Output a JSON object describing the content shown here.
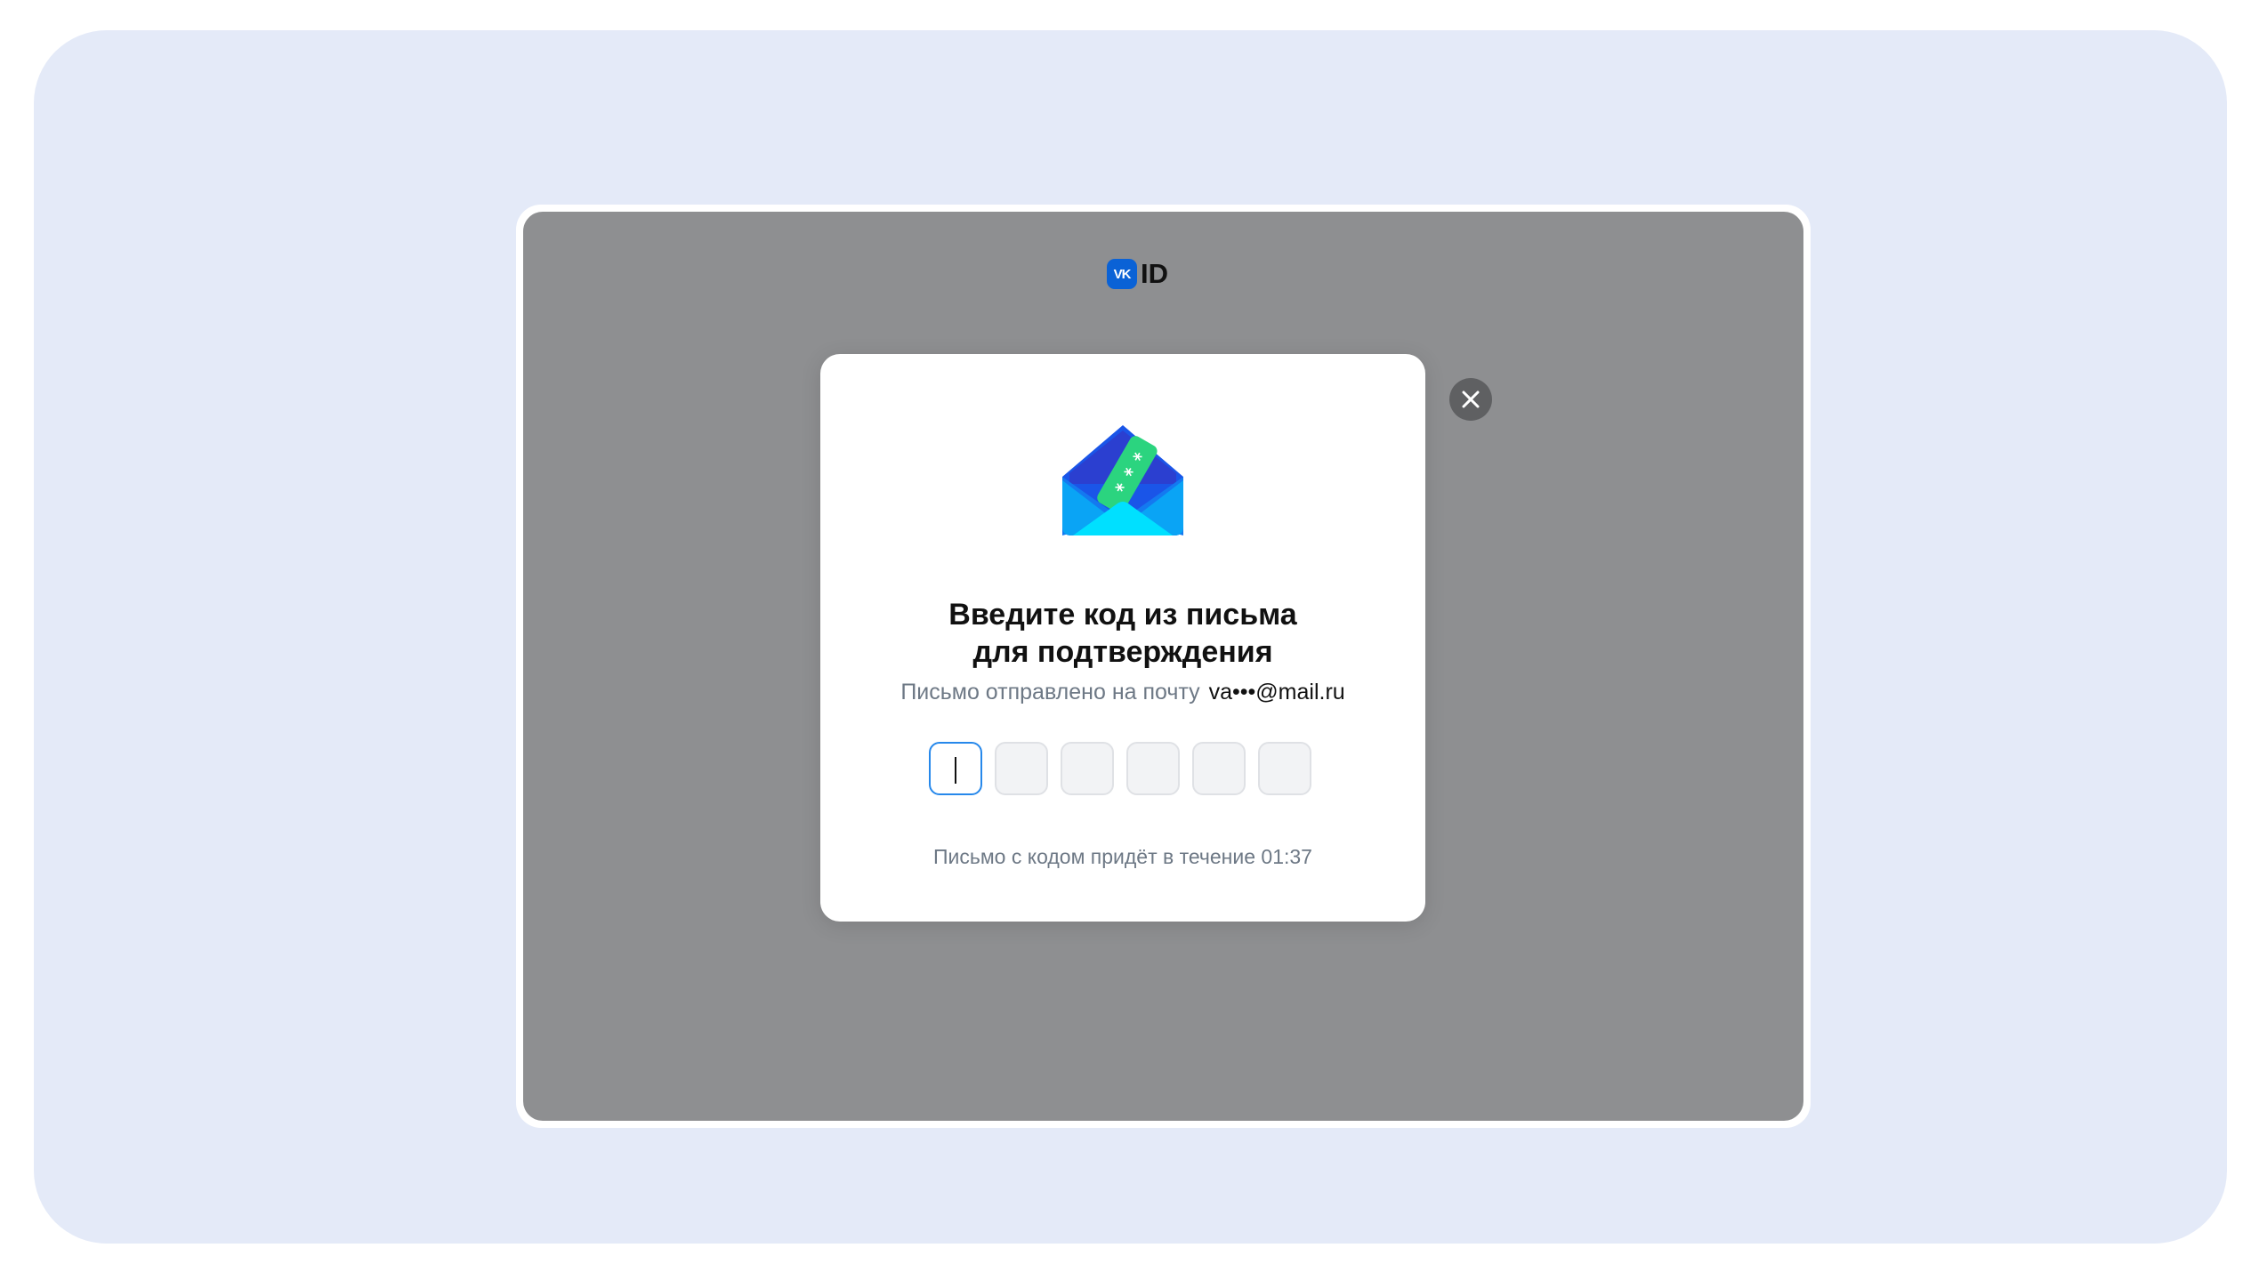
{
  "brand": {
    "badge_text": "VK",
    "id_text": "ID",
    "badge_color": "#0a62d6"
  },
  "dialog": {
    "title_line1": "Введите код из письма",
    "title_line2": "для подтверждения",
    "sent_label": "Письмо отправлено на почту",
    "email": "va•••@mail.ru",
    "code_length": 6,
    "timer_text": "Письмо с кодом придёт в течение 01:37",
    "illustration_icon": "envelope-with-code-icon"
  },
  "controls": {
    "close_icon": "close-icon"
  },
  "colors": {
    "page_background": "#e4eaf8",
    "overlay": "#8e8f91",
    "active_input_border": "#2688eb",
    "secondary_text": "#6d7885"
  }
}
